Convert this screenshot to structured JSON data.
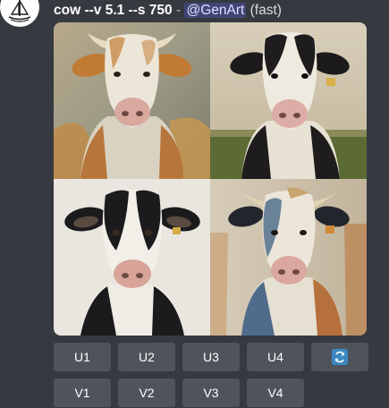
{
  "message": {
    "prompt": "cow --v 5.1 --s 750",
    "separator": "-",
    "mention": "@GenArt",
    "speed": "(fast)"
  },
  "images": [
    {
      "subject": "cow",
      "palette": "brown-white"
    },
    {
      "subject": "cow",
      "palette": "black-white-field"
    },
    {
      "subject": "cow",
      "palette": "black-white"
    },
    {
      "subject": "cow",
      "palette": "white-blue-brown"
    }
  ],
  "buttons": {
    "upscale": [
      "U1",
      "U2",
      "U3",
      "U4"
    ],
    "variation": [
      "V1",
      "V2",
      "V3",
      "V4"
    ],
    "reroll_icon": "refresh-icon"
  },
  "colors": {
    "background": "#36393f",
    "button": "#4f545c",
    "mention_text": "#dee0fc",
    "reroll_blue": "#3b88c3"
  }
}
